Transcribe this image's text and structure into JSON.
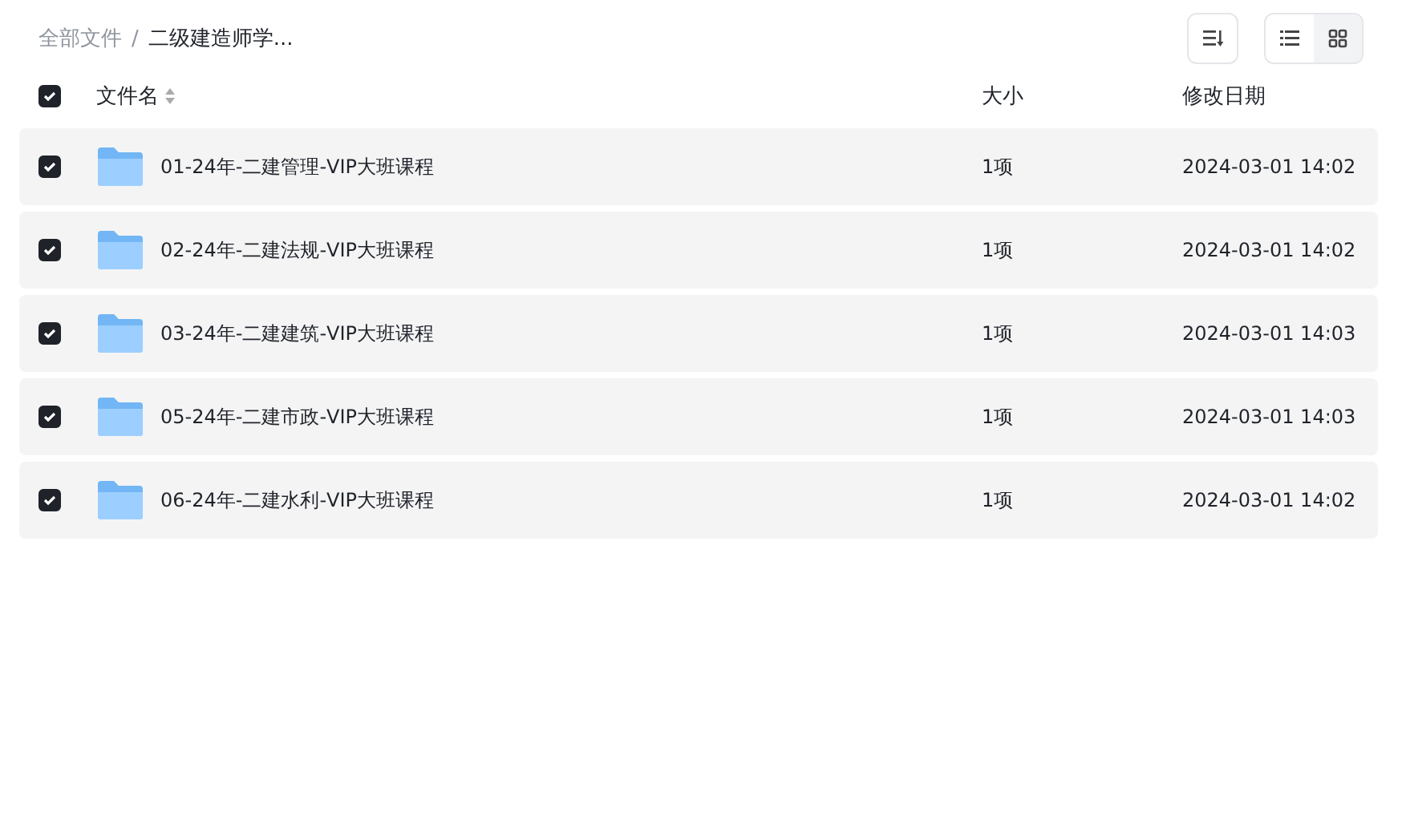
{
  "breadcrumb": [
    {
      "label": "全部文件",
      "current": false
    },
    {
      "label": "二级建造师学...",
      "current": true
    }
  ],
  "breadcrumb_separator": "/",
  "view_toggle": [
    {
      "kind": "list",
      "selected": true
    },
    {
      "kind": "grid",
      "selected": false
    }
  ],
  "table": {
    "select_all": {
      "checked": true
    },
    "columns": [
      {
        "label": "文件名",
        "sortable": true
      },
      {
        "label": "大小",
        "sortable": false
      },
      {
        "label": "修改日期",
        "sortable": false
      }
    ],
    "rows": [
      {
        "checked": true,
        "name": "01-24年-二建管理-VIP大班课程",
        "size": "1项",
        "modified": "2024-03-01 14:02"
      },
      {
        "checked": true,
        "name": "02-24年-二建法规-VIP大班课程",
        "size": "1项",
        "modified": "2024-03-01 14:02"
      },
      {
        "checked": true,
        "name": "03-24年-二建建筑-VIP大班课程",
        "size": "1项",
        "modified": "2024-03-01 14:03"
      },
      {
        "checked": true,
        "name": "05-24年-二建市政-VIP大班课程",
        "size": "1项",
        "modified": "2024-03-01 14:03"
      },
      {
        "checked": true,
        "name": "06-24年-二建水利-VIP大班课程",
        "size": "1项",
        "modified": "2024-03-01 14:02"
      }
    ]
  }
}
